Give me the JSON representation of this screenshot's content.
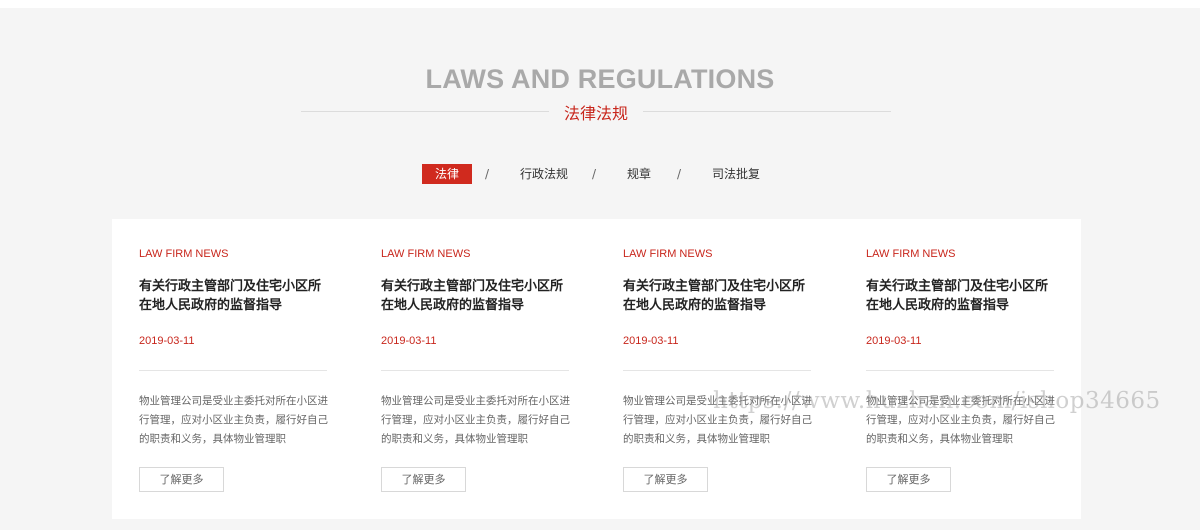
{
  "heading": {
    "en": "LAWS AND REGULATIONS",
    "cn": "法律法规"
  },
  "tabs": [
    {
      "label": "法律",
      "active": true
    },
    {
      "label": "行政法规",
      "active": false
    },
    {
      "label": "规章",
      "active": false
    },
    {
      "label": "司法批复",
      "active": false
    }
  ],
  "tab_separator": "/",
  "cards": [
    {
      "kicker": "LAW FIRM NEWS",
      "title": "有关行政主管部门及住宅小区所在地人民政府的监督指导",
      "date": "2019-03-11",
      "desc": "物业管理公司是受业主委托对所在小区进行管理，应对小区业主负责，履行好自己的职责和义务，具体物业管理职",
      "button": "了解更多"
    },
    {
      "kicker": "LAW FIRM NEWS",
      "title": "有关行政主管部门及住宅小区所在地人民政府的监督指导",
      "date": "2019-03-11",
      "desc": "物业管理公司是受业主委托对所在小区进行管理，应对小区业主负责，履行好自己的职责和义务，具体物业管理职",
      "button": "了解更多"
    },
    {
      "kicker": "LAW FIRM NEWS",
      "title": "有关行政主管部门及住宅小区所在地人民政府的监督指导",
      "date": "2019-03-11",
      "desc": "物业管理公司是受业主委托对所在小区进行管理，应对小区业主负责，履行好自己的职责和义务，具体物业管理职",
      "button": "了解更多"
    },
    {
      "kicker": "LAW FIRM NEWS",
      "title": "有关行政主管部门及住宅小区所在地人民政府的监督指导",
      "date": "2019-03-11",
      "desc": "物业管理公司是受业主委托对所在小区进行管理，应对小区业主负责，履行好自己的职责和义务，具体物业管理职",
      "button": "了解更多"
    }
  ],
  "watermark": "https://www.huzhan.com/ishop34665",
  "colors": {
    "accent": "#c8261c",
    "background": "#f5f5f5",
    "panel": "#ffffff"
  }
}
